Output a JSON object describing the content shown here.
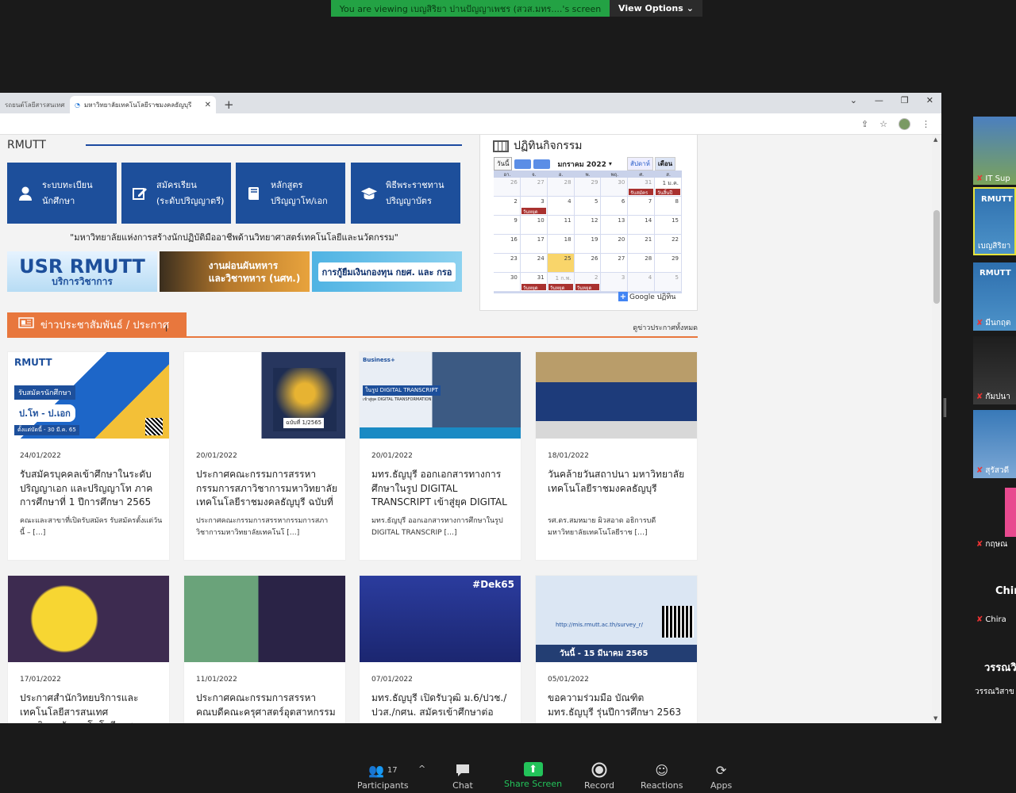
{
  "banner": {
    "viewing_text": "You are viewing เบญสิริยา ปานปัญญาเพชร (สวส.มทร....'s screen",
    "options_label": "View Options"
  },
  "browser": {
    "tabs": [
      {
        "label": "รถยนต์โลยีสารสนเทศ"
      },
      {
        "label": "มหาวิทยาลัยเทคโนโลยีราชมงคลธัญบุรี"
      }
    ]
  },
  "page": {
    "section_title": "RMUTT",
    "quick_buttons": [
      {
        "line1": "ระบบทะเบียน",
        "line2": "นักศึกษา",
        "icon": "person-icon"
      },
      {
        "line1": "สมัครเรียน",
        "line2": "(ระดับปริญญาตรี)",
        "icon": "edit-icon"
      },
      {
        "line1": "หลักสูตร",
        "line2": "ปริญญาโท/เอก",
        "icon": "book-icon"
      },
      {
        "line1": "พิธีพระราชทาน",
        "line2": "ปริญญาบัตร",
        "icon": "graduation-cap-icon"
      }
    ],
    "slogan": "\"มหาวิทยาลัยแห่งการสร้างนักปฏิบัติมืออาชีพด้านวิทยาศาสตร์เทคโนโลยีและนวัตกรรม\"",
    "banners": {
      "usr_line1": "USR RMUTT",
      "usr_line2": "บริการวิชาการ",
      "veteran_line1": "งานผ่อนผันทหาร",
      "veteran_line2": "และวิชาทหาร (นศท.)",
      "loan": "การกู้ยืมเงินกองทุน กยศ. และ กรอ"
    },
    "calendar": {
      "title": "ปฏิทินกิจกรรม",
      "today_btn": "วันนี้",
      "month_label": "มกราคม 2022",
      "views": [
        "สัปดาห์",
        "เดือน"
      ],
      "dow": [
        "อา.",
        "จ.",
        "อ.",
        "พ.",
        "พฤ.",
        "ศ.",
        "ส."
      ],
      "weeks": [
        [
          "26",
          "27",
          "28",
          "29",
          "30",
          "31",
          "1 ม.ค."
        ],
        [
          "2",
          "3",
          "4",
          "5",
          "6",
          "7",
          "8"
        ],
        [
          "9",
          "10",
          "11",
          "12",
          "13",
          "14",
          "15"
        ],
        [
          "16",
          "17",
          "18",
          "19",
          "20",
          "21",
          "22"
        ],
        [
          "23",
          "24",
          "25",
          "26",
          "27",
          "28",
          "29"
        ],
        [
          "30",
          "31",
          "1 ก.พ.",
          "2",
          "3",
          "4",
          "5"
        ]
      ],
      "events": {
        "w0d5": "รับสมัคร",
        "w0d6": "วันสิ้นปี",
        "w1d1": "วันหยุด",
        "w5d1": "วันหยุด",
        "w5d2": "วันหยุด",
        "w5d3": "วันหยุด"
      },
      "google_label": "Google ปฏิทิน"
    },
    "news_title": "ข่าวประชาสัมพันธ์ / ประกาศ",
    "news_all": "ดูข่าวประกาศทั้งหมด",
    "cards": [
      {
        "date": "24/01/2022",
        "title": "รับสมัครบุคคลเข้าศึกษาในระดับปริญญาเอก และปริญญาโท ภาคการศึกษาที่ 1 ปีการศึกษา 2565",
        "excerpt": "คณะและสาขาที่เปิดรับสมัคร รับสมัครตั้งแต่วันนี้ – […]"
      },
      {
        "date": "20/01/2022",
        "title": "ประกาศคณะกรรมการสรรหากรรมการสภาวิชาการมหาวิทยาลัยเทคโนโลยีราชมงคลธัญบุรี ฉบับที่",
        "excerpt": "ประกาศคณะกรรมการสรรหากรรมการสภาวิชาการมหาวิทยาลัยเทคโนโ […]"
      },
      {
        "date": "20/01/2022",
        "title": "มทร.ธัญบุรี ออกเอกสารทางการศึกษาในรูป DIGITAL TRANSCRIPT เข้าสู่ยุค DIGITAL",
        "excerpt": "มทร.ธัญบุรี ออกเอกสารทางการศึกษาในรูป DIGITAL TRANSCRIP […]"
      },
      {
        "date": "18/01/2022",
        "title": "วันคล้ายวันสถาปนา มหาวิทยาลัยเทคโนโลยีราชมงคลธัญบุรี",
        "excerpt": "รศ.ดร.สมหมาย ผิวสอาด อธิการบดีมหาวิทยาลัยเทคโนโลยีราช […]"
      },
      {
        "date": "17/01/2022",
        "title": "ประกาศสำนักวิทยบริการและเทคโนโลยีสารสนเทศ มหาวิทยาลัยเทคโนโลยีราชมงคลธัญบุรี",
        "excerpt": ""
      },
      {
        "date": "11/01/2022",
        "title": "ประกาศคณะกรรมการสรรหาคณบดีคณะครุศาสตร์อุตสาหกรรม",
        "excerpt": ""
      },
      {
        "date": "07/01/2022",
        "title": "มทร.ธัญบุรี เปิดรับวุฒิ ม.6/ปวช./ปวส./กศน. สมัครเข้าศึกษาต่อ",
        "excerpt": ""
      },
      {
        "date": "05/01/2022",
        "title": "ขอความร่วมมือ บัณฑิต มทร.ธัญบุรี รุ่นปีการศึกษา 2563",
        "excerpt": ""
      }
    ],
    "thumb_text": {
      "c1_badge": "รับสมัครนักศึกษา",
      "c1_level": "ป.โท - ป.เอก",
      "c1_period": "ตั้งแต่บัดนี้ - 30 มี.ค. 65",
      "c2_issue": "ฉบับที่ 1/2565",
      "c3_tag": "Business+",
      "c3_headline": "ในรูป DIGITAL TRANSCRIPT",
      "c3_sub": "เข้าสู่ยุค DIGITAL TRANSFORMATION",
      "c7_tag": "#Dek65",
      "c8_date": "วันนี้ - 15 มีนาคม 2565",
      "c8_url": "http://mis.rmutt.ac.th/survey_r/"
    }
  },
  "participants": [
    {
      "name": "IT Sup"
    },
    {
      "name": "เบญสิริยา"
    },
    {
      "name": "มีนกฤต"
    },
    {
      "name": "กัมปนา"
    },
    {
      "name": "สุรัสวดี"
    },
    {
      "name": "กฤษณ"
    },
    {
      "name": "Chira",
      "big": "Chir"
    },
    {
      "name": "วรรณวิสาข",
      "big": "วรรณวิ"
    }
  ],
  "toolbar": {
    "participants_label": "Participants",
    "participants_count": "17",
    "chat_label": "Chat",
    "share_label": "Share Screen",
    "record_label": "Record",
    "reactions_label": "Reactions",
    "apps_label": "Apps"
  },
  "colors": {
    "accent_blue": "#1d4f9b",
    "news_orange": "#e8773d",
    "zoom_green": "#23a244"
  }
}
